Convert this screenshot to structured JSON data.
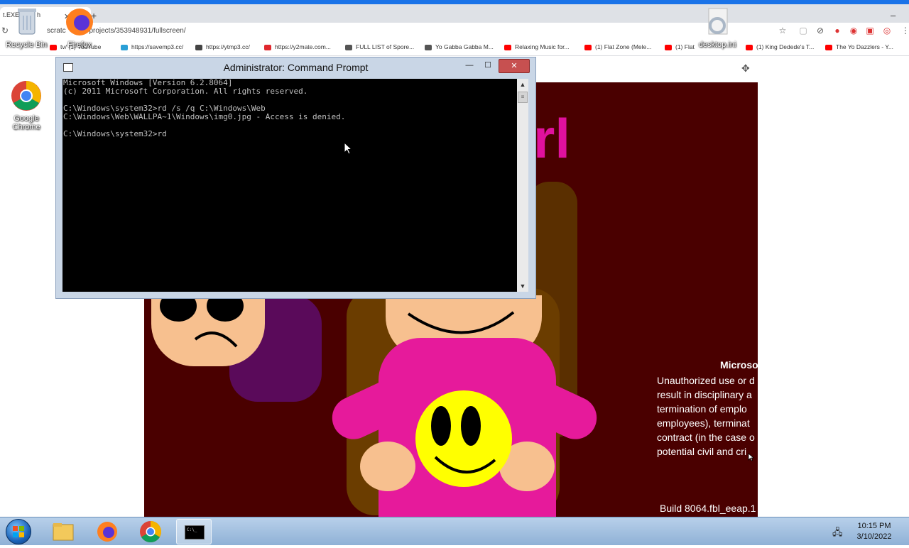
{
  "browser": {
    "tab_label": "t.EXE",
    "tab_title_fragment": "h",
    "tab_close_icon": "close-icon",
    "url_prefix": "scratc",
    "url": "/projects/353948931/fullscreen/",
    "bookmarks": [
      {
        "label": "tv/ (1) YouTube",
        "icon_color": "#ff0000"
      },
      {
        "label": "https://savemp3.cc/",
        "icon_color": "#2a9fd6"
      },
      {
        "label": "https://ytmp3.cc/",
        "icon_color": "#444444"
      },
      {
        "label": "https://y2mate.com...",
        "icon_color": "#e0282e"
      },
      {
        "label": "FULL LIST of Spore...",
        "icon_color": "#555555"
      },
      {
        "label": "Yo Gabba Gabba M...",
        "icon_color": "#555555"
      },
      {
        "label": "Relaxing Music for...",
        "icon_color": "#ff0000"
      },
      {
        "label": "(1) Flat Zone (Mele...",
        "icon_color": "#ff0000"
      },
      {
        "label": "(1) Flat",
        "icon_color": "#ff0000"
      },
      {
        "label": "(1) King Dedede's T...",
        "icon_color": "#ff0000"
      },
      {
        "label": "The Yo Dazzlers - Y...",
        "icon_color": "#ff0000"
      }
    ]
  },
  "desktop": {
    "icons": [
      {
        "label": "Recycle Bin",
        "icon": "recycle-bin-icon"
      },
      {
        "label": "Firefox",
        "icon": "firefox-icon"
      },
      {
        "label": "desktop.ini",
        "icon": "settings-file-icon"
      },
      {
        "label1": "Google",
        "label2": "Chrome",
        "icon": "chrome-icon"
      }
    ]
  },
  "stage": {
    "title_fragment": "rl",
    "warning_title": "Microso",
    "warning_lines": [
      "Unauthorized use or d",
      "result in disciplinary a",
      "termination of emplo",
      "employees), terminat",
      "contract (in the case o",
      "potential civil and cri"
    ],
    "build": "Build 8064.fbl_eeap.1"
  },
  "cmd": {
    "title": "Administrator: Command Prompt",
    "lines": [
      "Microsoft Windows [Version 6.2.8064]",
      "(c) 2011 Microsoft Corporation. All rights reserved.",
      "",
      "C:\\Windows\\system32>rd /s /q C:\\Windows\\Web",
      "C:\\Windows\\Web\\WALLPA~1\\Windows\\img0.jpg - Access is denied.",
      "",
      "C:\\Windows\\system32>rd"
    ],
    "minimize_symbol": "—",
    "maximize_symbol": "☐",
    "close_symbol": "✕",
    "scroll_up_symbol": "▲",
    "scroll_down_symbol": "▼",
    "scroll_thumb_symbol": "≡"
  },
  "taskbar": {
    "apps": [
      {
        "name": "file-explorer",
        "active": false
      },
      {
        "name": "firefox",
        "active": false
      },
      {
        "name": "chrome",
        "active": false
      },
      {
        "name": "command-prompt",
        "active": true
      }
    ],
    "cmd_icon_label": "C:\\_",
    "time": "10:15 PM",
    "date": "3/10/2022"
  },
  "colors": {
    "stage_background": "#4a0000",
    "stage_text": "#e0119e",
    "shirt": "#e61a9b",
    "smiley": "#ffff00",
    "console_bg": "#000000",
    "console_fg": "#c0c0c0",
    "cmd_close": "#c75050",
    "chrome_accent": "#1a73e8"
  }
}
